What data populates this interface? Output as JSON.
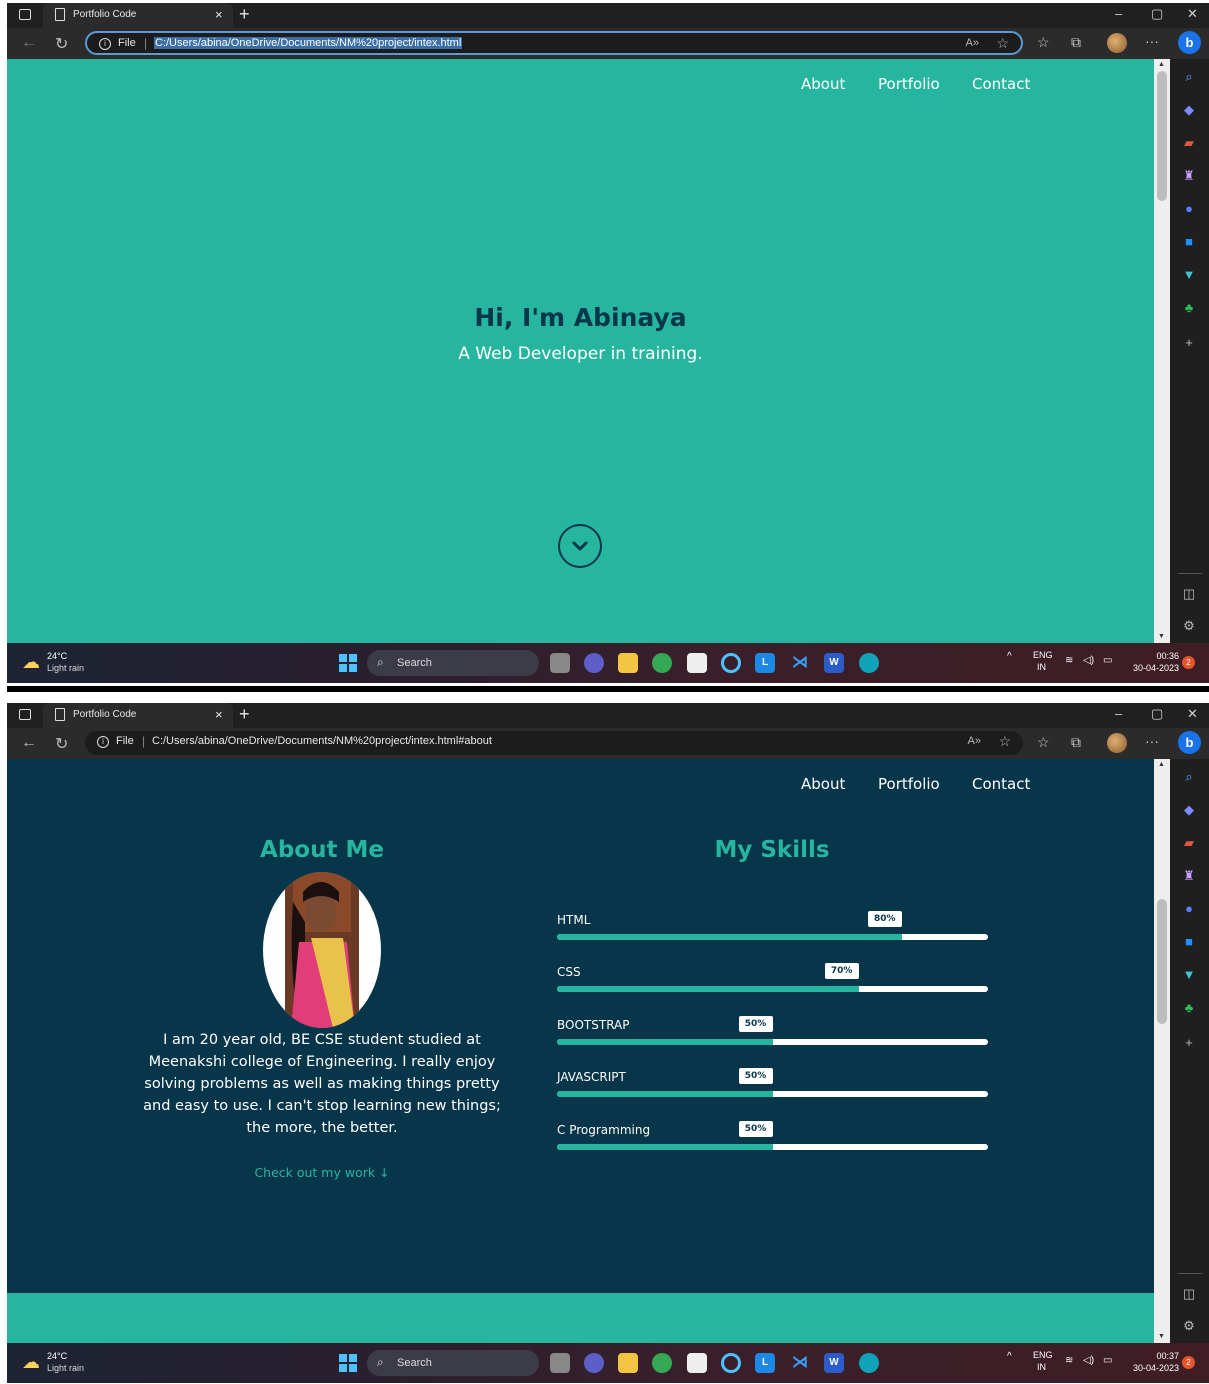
{
  "browser": {
    "tab_title": "Portfolio Code",
    "tab_close": "×",
    "new_tab": "+",
    "controls": {
      "minimize": "–",
      "restore": "▢",
      "close": "✕"
    },
    "file_label": "File",
    "separator": "|",
    "url_1": "C:/Users/abina/OneDrive/Documents/NM%20project/intex.html",
    "url_2": "C:/Users/abina/OneDrive/Documents/NM%20project/intex.html#about",
    "read_aloud": "A»",
    "more": "···",
    "bing_letter": "b",
    "icons": [
      "tab-actions-icon",
      "page-icon",
      "back-arrow-icon",
      "refresh-icon",
      "info-icon",
      "read-aloud-icon",
      "add-favorite-icon",
      "favorites-icon",
      "collections-icon",
      "profile-avatar",
      "more-icon",
      "bing-copilot-icon"
    ],
    "sidebar_icons": [
      "search-icon",
      "shopping-tag-icon",
      "tools-icon",
      "games-icon",
      "copilot-icon",
      "outlook-icon",
      "drop-icon",
      "tree-icon",
      "add-icon",
      "sidebar-toggle-icon",
      "settings-icon"
    ]
  },
  "site": {
    "nav": {
      "about": "About",
      "portfolio": "Portfolio",
      "contact": "Contact"
    },
    "hero": {
      "title": "Hi, I'm Abinaya",
      "subtitle": "A Web Developer in training."
    },
    "about": {
      "title": "About Me",
      "bio": "I am 20 year old, BE CSE student studied at Meenakshi college of Engineering. I really enjoy solving problems as well as making things pretty and easy to use. I can't stop learning new things; the more, the better.",
      "cta": "Check out my work ↓"
    },
    "skills": {
      "title": "My Skills",
      "items": [
        {
          "name": "HTML",
          "percent_label": "80%",
          "level": 0.8
        },
        {
          "name": "CSS",
          "percent_label": "70%",
          "level": 0.7
        },
        {
          "name": "BOOTSTRAP",
          "percent_label": "50%",
          "level": 0.5
        },
        {
          "name": "JAVASCRIPT",
          "percent_label": "50%",
          "level": 0.5
        },
        {
          "name": "C Programming",
          "percent_label": "50%",
          "level": 0.5
        }
      ]
    }
  },
  "taskbar": {
    "temperature": "24°C",
    "condition": "Light rain",
    "search": "Search",
    "lang_1": "ENG",
    "lang_2": "IN",
    "time_1": "00:36",
    "time_2": "00:37",
    "date": "30-04-2023",
    "notifications": "2",
    "apps": [
      "files-icon",
      "meet-icon",
      "folder-icon",
      "chrome-icon",
      "store-icon",
      "cortana-icon",
      "l-app-icon",
      "vscode-icon",
      "word-icon",
      "edge-icon"
    ]
  },
  "colors": {
    "teal": "#26b6a0",
    "navy": "#073549",
    "white": "#ffffff"
  }
}
